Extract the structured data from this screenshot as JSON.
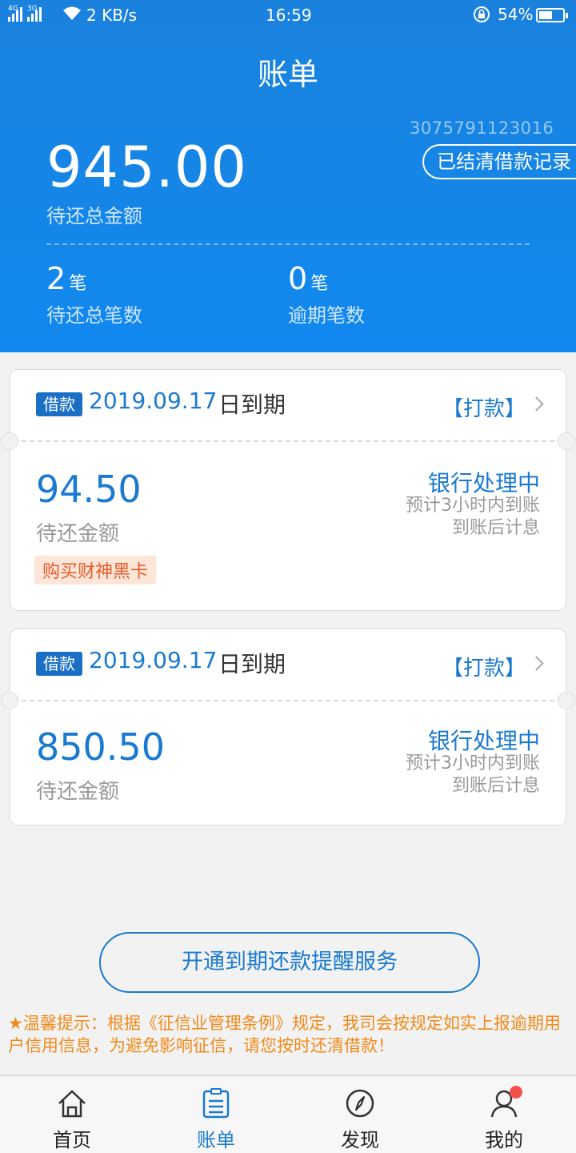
{
  "status_bar": {
    "net_tags": [
      "4G",
      "3G"
    ],
    "speed": "2 KB/s",
    "time": "16:59",
    "battery": "54%",
    "battery_level": 0.54
  },
  "header": {
    "title": "账单",
    "account_no": "3075791123016",
    "settled_button": "已结清借款记录",
    "total_amount": "945.00",
    "total_label": "待还总金额",
    "count_total": "2",
    "count_total_unit": "笔",
    "count_total_label": "待还总笔数",
    "count_overdue": "0",
    "count_overdue_unit": "笔",
    "count_overdue_label": "逾期笔数"
  },
  "loans": [
    {
      "tag": "借款",
      "due_date": "2019.09.17",
      "due_suffix": "日到期",
      "action": "【打款】",
      "amount": "94.50",
      "amount_label": "待还金额",
      "status": "银行处理中",
      "note1": "预计3小时内到账",
      "note2": "到账后计息",
      "promo": "购买财神黑卡"
    },
    {
      "tag": "借款",
      "due_date": "2019.09.17",
      "due_suffix": "日到期",
      "action": "【打款】",
      "amount": "850.50",
      "amount_label": "待还金额",
      "status": "银行处理中",
      "note1": "预计3小时内到账",
      "note2": "到账后计息"
    }
  ],
  "remind_button": "开通到期还款提醒服务",
  "tip": "★温馨提示：根据《征信业管理条例》规定，我司会按规定如实上报逾期用户信用信息，为避免影响征信，请您按时还清借款！",
  "tabs": [
    {
      "label": "首页",
      "icon": "home-icon"
    },
    {
      "label": "账单",
      "icon": "bill-icon",
      "active": true
    },
    {
      "label": "发现",
      "icon": "compass-icon"
    },
    {
      "label": "我的",
      "icon": "user-icon",
      "badge": true
    }
  ],
  "colors": {
    "brand_blue": "#1a7ad0",
    "header_blue": "#1189f0",
    "warning_orange": "#f08a1a",
    "promo_red": "#e85b2b"
  }
}
